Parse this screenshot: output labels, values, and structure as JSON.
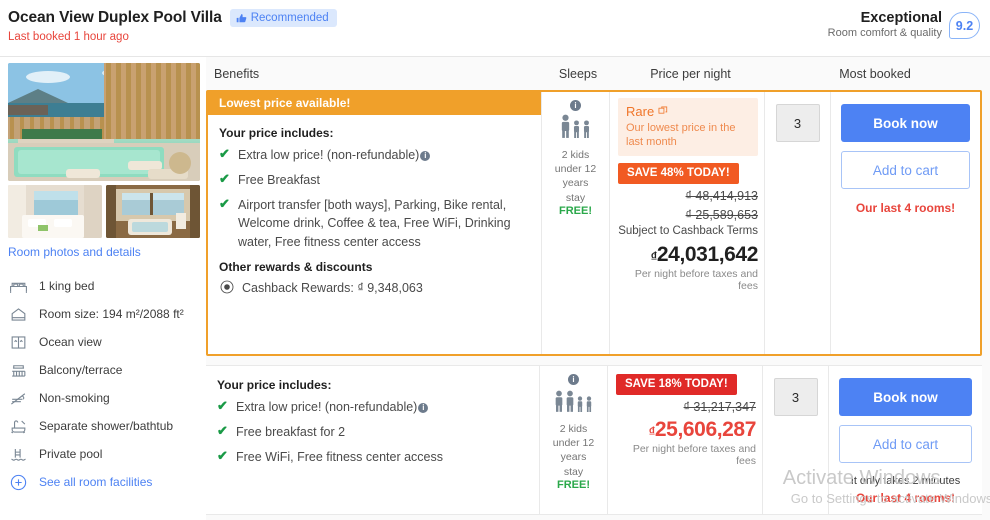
{
  "header": {
    "room_title": "Ocean View Duplex Pool Villa",
    "recommended_label": "Recommended",
    "last_booked": "Last booked 1 hour ago",
    "rating_word": "Exceptional",
    "rating_sub": "Room comfort & quality",
    "rating_score": "9.2"
  },
  "sidebar": {
    "photos_link": "Room photos and details",
    "facilities": [
      {
        "icon": "bed-icon",
        "label": "1 king bed"
      },
      {
        "icon": "room-size-icon",
        "label": "Room size: 194 m²/2088 ft²"
      },
      {
        "icon": "window-view-icon",
        "label": "Ocean view"
      },
      {
        "icon": "balcony-icon",
        "label": "Balcony/terrace"
      },
      {
        "icon": "non-smoking-icon",
        "label": "Non-smoking"
      },
      {
        "icon": "shower-bathtub-icon",
        "label": "Separate shower/bathtub"
      },
      {
        "icon": "pool-icon",
        "label": "Private pool"
      },
      {
        "icon": "plus-circle-icon",
        "label": "See all room facilities"
      }
    ]
  },
  "table": {
    "columns": {
      "benefits": "Benefits",
      "sleeps": "Sleeps",
      "price": "Price per night",
      "most_booked": "Most booked"
    }
  },
  "rows": [
    {
      "banner": "Lowest price available!",
      "benefits_head": "Your price includes:",
      "benefits": [
        "Extra low price! (non-refundable)",
        "Free Breakfast",
        "Airport transfer [both ways], Parking, Bike rental, Welcome drink, Coffee & tea, Free WiFi, Drinking water, Free fitness center access"
      ],
      "rewards_head": "Other rewards & discounts",
      "cashback_label": "Cashback Rewards: ₫ 9,348,063",
      "sleeps": {
        "adults": 1,
        "kids": 2,
        "text": "2 kids\nunder 12\nyears\nstay",
        "free": "FREE!"
      },
      "price": {
        "rare_title": "Rare",
        "rare_sub": "Our lowest price in the last month",
        "save_badge": "SAVE 48% TODAY!",
        "strike_1": "₫ 48,414,913",
        "strike_2": "₫ 25,589,653",
        "cashback_terms": "Subject to Cashback Terms",
        "currency": "₫",
        "amount": "24,031,642",
        "per_night": "Per night before taxes and fees"
      },
      "qty": "3",
      "book_label": "Book now",
      "cart_label": "Add to cart",
      "last_rooms": "Our last 4 rooms!"
    },
    {
      "banner": "",
      "benefits_head": "Your price includes:",
      "benefits": [
        "Extra low price! (non-refundable)",
        "Free breakfast for 2",
        "Free WiFi, Free fitness center access"
      ],
      "rewards_head": "",
      "cashback_label": "",
      "sleeps": {
        "adults": 2,
        "kids": 2,
        "text": "2 kids\nunder 12\nyears\nstay",
        "free": "FREE!"
      },
      "price": {
        "save_badge": "SAVE 18% TODAY!",
        "strike_1": "₫ 31,217,347",
        "currency": "₫",
        "amount": "25,606,287",
        "per_night": "Per night before taxes and fees"
      },
      "qty": "3",
      "book_label": "Book now",
      "cart_label": "Add to cart",
      "takes_minutes": "It only takes 2 minutes",
      "last_rooms": "Our last 4 rooms!"
    }
  ],
  "watermark": {
    "line1": "Activate Windows",
    "line2": "Go to Settings to activate Windows."
  },
  "colors": {
    "orange": "#f0a02a",
    "orange_red": "#f15a22",
    "red": "#e02a28",
    "blue": "#4d82f3",
    "green": "#1a9a46"
  }
}
